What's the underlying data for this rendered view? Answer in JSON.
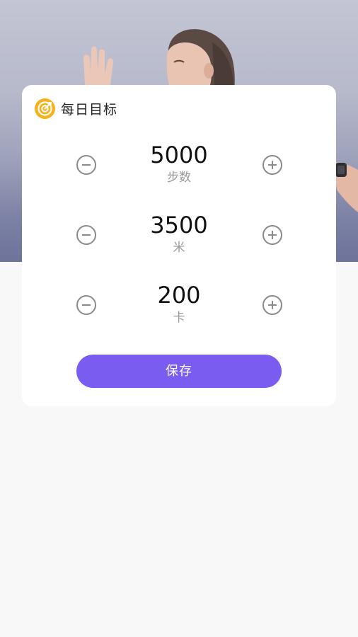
{
  "card": {
    "title": "每日目标",
    "icon": "target-icon",
    "accent_color": "#f5b21b"
  },
  "goals": [
    {
      "value": "5000",
      "unit": "步数"
    },
    {
      "value": "3500",
      "unit": "米"
    },
    {
      "value": "200",
      "unit": "卡"
    }
  ],
  "buttons": {
    "save_label": "保存",
    "save_color": "#7b5cf0",
    "decrement_icon": "minus-circle-icon",
    "increment_icon": "plus-circle-icon"
  }
}
